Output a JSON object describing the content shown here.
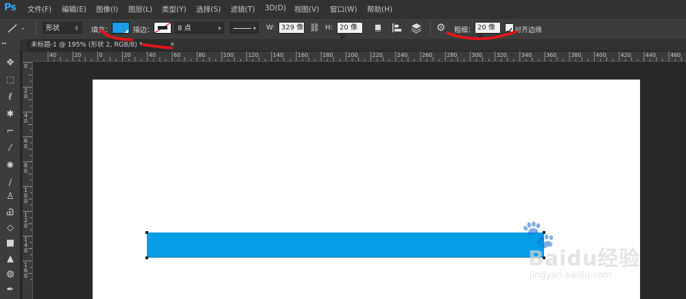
{
  "app": {
    "logo": "Ps"
  },
  "menu": [
    "文件(F)",
    "编辑(E)",
    "图像(I)",
    "图层(L)",
    "类型(Y)",
    "选择(S)",
    "滤镜(T)",
    "3D(D)",
    "视图(V)",
    "窗口(W)",
    "帮助(H)"
  ],
  "options": {
    "mode": "形状",
    "fill_label": "填充：",
    "fill_color": "#1e9be6",
    "stroke_label": "描边：",
    "stroke_width": "8 点",
    "w_label": "W:",
    "w_value": "329 像",
    "h_label": "H:",
    "h_value": "20 像素",
    "weight_label": "粗细：",
    "weight_value": "20 像素",
    "align_edges": "对齐边缘",
    "align_checked": true
  },
  "document": {
    "tab_title": "未标题-1 @ 195% (形状 2, RGB/8) *"
  },
  "rulers": {
    "h_labels": [
      "40",
      "20",
      "0",
      "20",
      "40",
      "60",
      "80",
      "100",
      "120",
      "140",
      "160",
      "180",
      "200",
      "220",
      "240",
      "260",
      "280",
      "300",
      "320",
      "340",
      "360",
      "380",
      "400",
      "420",
      "440",
      "460",
      "480"
    ],
    "v_labels": [
      "0",
      "2\n0",
      "4\n0",
      "6\n0",
      "8\n0",
      "1\n0\n0",
      "1\n2\n0",
      "1\n4\n0",
      "1\n6\n0"
    ]
  },
  "shape": {
    "color": "#049de6"
  },
  "watermark": {
    "brand": "Baidu经验",
    "url": "jingyan.baidu.com"
  }
}
